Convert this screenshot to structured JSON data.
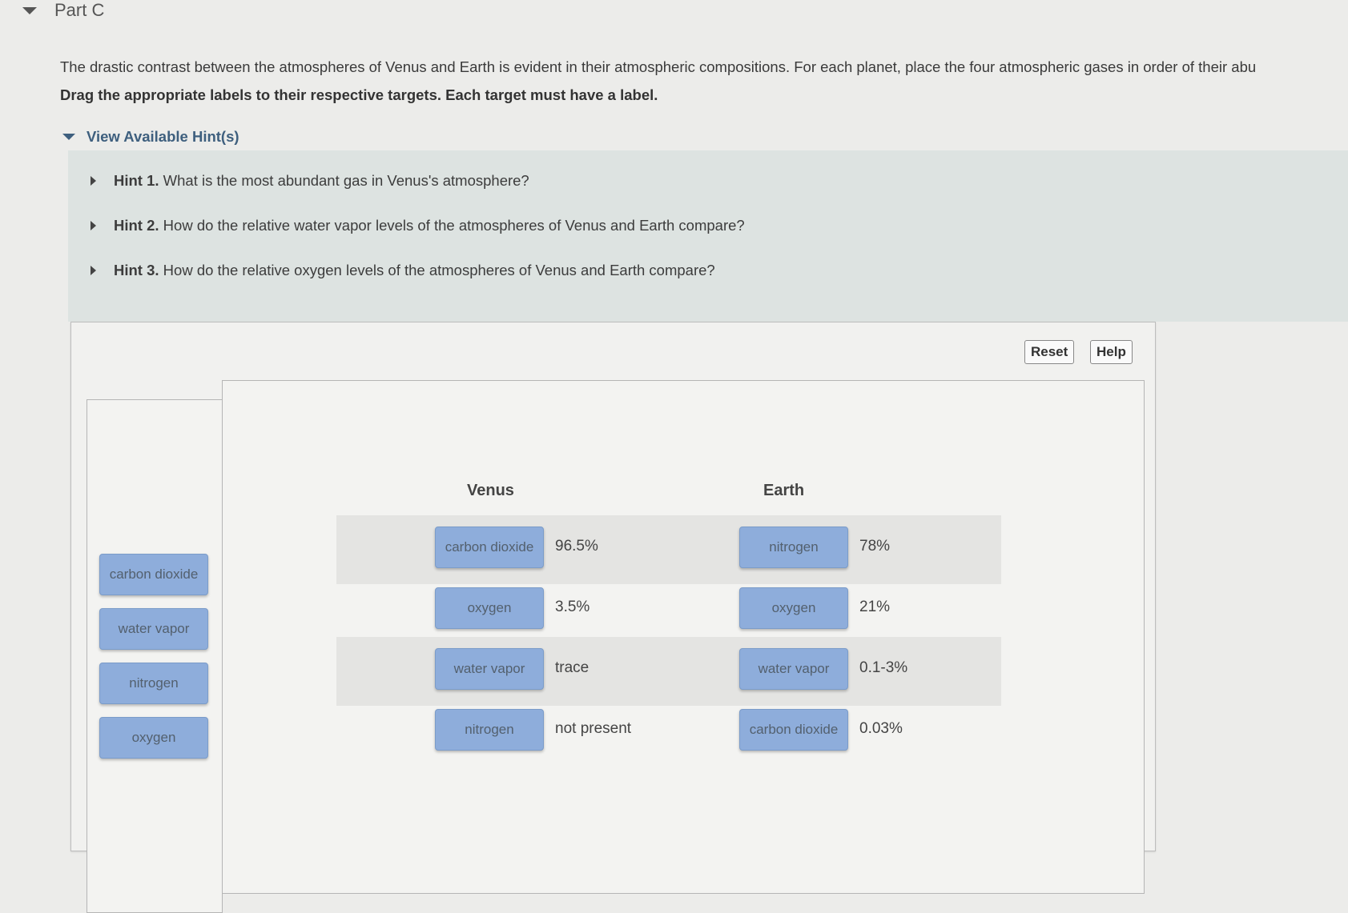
{
  "part": {
    "title": "Part C"
  },
  "question": {
    "text": "The drastic contrast between the atmospheres of Venus and Earth is evident in their atmospheric compositions. For each planet, place the four atmospheric gases in order of their abu",
    "instruction": "Drag the appropriate labels to their respective targets. Each target must have a label."
  },
  "hints": {
    "toggle_label": "View Available Hint(s)",
    "items": [
      {
        "num": "Hint 1.",
        "text": "What is the most abundant gas in Venus's atmosphere?"
      },
      {
        "num": "Hint 2.",
        "text": "How do the relative water vapor levels of the atmospheres of Venus and Earth compare?"
      },
      {
        "num": "Hint 3.",
        "text": "How do the relative oxygen levels of the atmospheres of Venus and Earth compare?"
      }
    ]
  },
  "toolbar": {
    "reset_label": "Reset",
    "help_label": "Help"
  },
  "label_bank": [
    "carbon dioxide",
    "water vapor",
    "nitrogen",
    "oxygen"
  ],
  "venus": {
    "heading": "Venus",
    "rows": [
      {
        "label": "carbon dioxide",
        "value": "96.5%"
      },
      {
        "label": "oxygen",
        "value": "3.5%"
      },
      {
        "label": "water vapor",
        "value": "trace"
      },
      {
        "label": "nitrogen",
        "value": "not present"
      }
    ]
  },
  "earth": {
    "heading": "Earth",
    "rows": [
      {
        "label": "nitrogen",
        "value": "78%"
      },
      {
        "label": "oxygen",
        "value": "21%"
      },
      {
        "label": "water vapor",
        "value": "0.1-3%"
      },
      {
        "label": "carbon dioxide",
        "value": "0.03%"
      }
    ]
  },
  "colors": {
    "chip_fill": "#8eaddb",
    "hint_accent": "#3e5f7e",
    "hint_panel": "#dde3e1"
  },
  "icons": {
    "collapse": "triangle-down-icon",
    "expand": "triangle-right-icon"
  }
}
